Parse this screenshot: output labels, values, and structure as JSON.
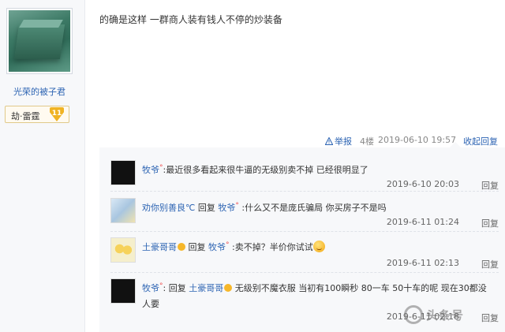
{
  "author": {
    "name": "光荣的被子君",
    "level_title": "劫·雷霆",
    "level_num": "11"
  },
  "post": {
    "text": "的确是这样 一群商人装有钱人不停的炒装备",
    "report": "举报",
    "floor": "4楼",
    "time": "2019-06-10 19:57",
    "collapse": "收起回复"
  },
  "replies": [
    {
      "user": "牧爷",
      "vip": "°",
      "sep": ":",
      "text": "最近很多看起来很牛逼的无级别卖不掉 已经很明显了",
      "time": "2019-6-10 20:03",
      "action": "回复",
      "avatar_color": "#111111"
    },
    {
      "user": "劝你别善良℃",
      "reply_word": "回复",
      "target": "牧爷",
      "vip": "°",
      "sep": ":",
      "text": "什么又不是庞氏骗局 你买房子不是吗",
      "time": "2019-6-11 01:24",
      "action": "回复",
      "avatar_color": "#cfe0ee"
    },
    {
      "user": "土豪哥哥",
      "reply_word": "回复",
      "target": "牧爷",
      "vip": "°",
      "sep": ":",
      "text": "卖不掉？半价你试试",
      "time": "2019-6-11 02:13",
      "action": "回复",
      "avatar_color": "#f3ecc2"
    },
    {
      "user": "牧爷",
      "vip": "°",
      "reply_word": "回复",
      "target": "土豪哥哥",
      "sep": ":",
      "text": "无级别不魔衣服 当初有100瞬秒 80一车 50十车的呢 现在30都没人要",
      "time": "2019-6-11 02:18",
      "action": "回复",
      "avatar_color": "#111111"
    }
  ],
  "watermark": {
    "text": "头条号"
  },
  "colors": {
    "link": "#2d64b3",
    "badge": "#f0b323",
    "reply_bg": "#f7f8fa"
  }
}
